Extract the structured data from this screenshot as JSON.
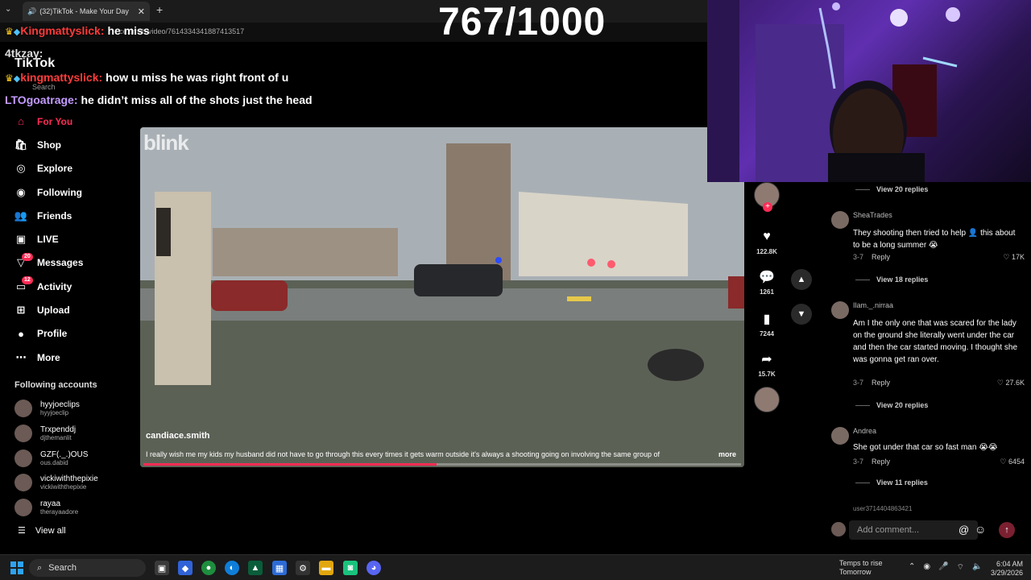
{
  "browser": {
    "tab_title": "(32)TikTok - Make Your Day",
    "url": "ce.smith/video/7614334341887413517"
  },
  "counter": "767/1000",
  "chat": [
    {
      "user": "Kingmattyslick:",
      "message": "he miss",
      "color": "#ff3b3b"
    },
    {
      "user": "4tkzay:",
      "message": "",
      "color": "#dddddd"
    },
    {
      "user": "kingmattyslick:",
      "message": "how u miss he was right front of u",
      "color": "#ff3b3b"
    },
    {
      "user": "LTOgoatrage:",
      "message": "he didn’t miss all of the shots just the head",
      "color": "#c39bff"
    }
  ],
  "tiktok": {
    "logo": "TikTok",
    "search_placeholder": "Search"
  },
  "nav": [
    {
      "label": "For You",
      "icon": "home-icon",
      "glyph": "⌂",
      "active": true
    },
    {
      "label": "Shop",
      "icon": "shop-icon",
      "glyph": "🛍"
    },
    {
      "label": "Explore",
      "icon": "compass-icon",
      "glyph": "◎"
    },
    {
      "label": "Following",
      "icon": "following-icon",
      "glyph": "◉"
    },
    {
      "label": "Friends",
      "icon": "friends-icon",
      "glyph": "👥"
    },
    {
      "label": "LIVE",
      "icon": "live-icon",
      "glyph": "▣"
    },
    {
      "label": "Messages",
      "icon": "messages-icon",
      "glyph": "▽",
      "badge": "20"
    },
    {
      "label": "Activity",
      "icon": "activity-icon",
      "glyph": "▭",
      "badge": "12"
    },
    {
      "label": "Upload",
      "icon": "upload-icon",
      "glyph": "⊞"
    },
    {
      "label": "Profile",
      "icon": "profile-icon",
      "glyph": "●"
    },
    {
      "label": "More",
      "icon": "more-icon",
      "glyph": "⋯"
    }
  ],
  "following_accounts": {
    "title": "Following accounts",
    "accounts": [
      {
        "name": "hyyjoeclips",
        "handle": "hyyjoeclip"
      },
      {
        "name": "Trxpenddj",
        "handle": "djthemanlit"
      },
      {
        "name": "GZF(._.)OUS",
        "handle": "ous.dabid"
      },
      {
        "name": "vickiwiththepixie",
        "handle": "vickiwiththepixie"
      },
      {
        "name": "rayaa",
        "handle": "therayaadore"
      }
    ],
    "view_all": "View all"
  },
  "video": {
    "watermark": "blink",
    "author": "candiace.smith",
    "description": "I really wish me my kids my husband did not have to go through this every times it gets warm outside it's always a shooting going on involving the same group of",
    "more": "more",
    "progress": 0.49
  },
  "actions": {
    "likes": "122.8K",
    "comments": "1261",
    "saves": "7244",
    "shares": "15.7K"
  },
  "comments": [
    {
      "view_replies": "View 20 replies"
    },
    {
      "user": "SheaTrades",
      "text": "They shooting then tried to help 👤 this about to be a long summer 😭",
      "date": "3-7",
      "reply": "Reply",
      "likes": "17K",
      "view_replies": "View 18 replies"
    },
    {
      "user": "Ilam._.nirraa",
      "text": "Am I the only one that was scared for the lady on the ground she literally went under the car and then the car started moving. I thought she was gonna get ran over.",
      "date": "3-7",
      "reply": "Reply",
      "likes": "27.6K",
      "view_replies": "View 20 replies"
    },
    {
      "user": "Andrea",
      "text": "She got under that car so fast man 😭😭",
      "date": "3-7",
      "reply": "Reply",
      "likes": "6454",
      "view_replies": "View 11 replies"
    }
  ],
  "comment_tail_user": "user3714404863421",
  "add_comment_placeholder": "Add comment...",
  "taskbar": {
    "search": "Search",
    "weather_line1": "Temps to rise",
    "weather_line2": "Tomorrow",
    "time": "6:04 AM",
    "date": "3/29/2026"
  }
}
